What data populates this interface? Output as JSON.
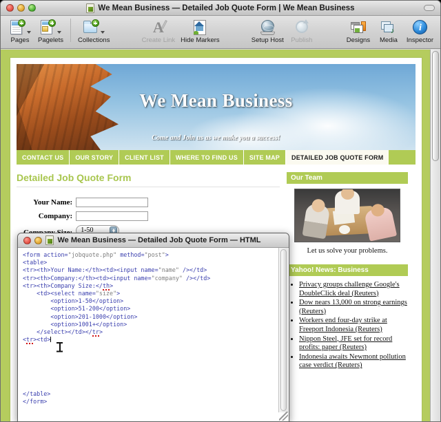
{
  "window": {
    "title": "We Mean Business — Detailed Job Quote Form | We Mean Business",
    "traffic": {
      "close": "close",
      "minimize": "minimize",
      "zoom": "zoom"
    }
  },
  "toolbar": {
    "items": [
      {
        "label": "Pages",
        "icon": "pages-icon",
        "dimmed": false,
        "caret": true
      },
      {
        "label": "Pagelets",
        "icon": "pagelets-icon",
        "dimmed": false,
        "caret": true
      },
      {
        "label": "Collections",
        "icon": "collections-icon",
        "dimmed": false,
        "caret": true
      },
      {
        "label": "Create Link",
        "icon": "create-link-icon",
        "dimmed": true,
        "caret": false
      },
      {
        "label": "Hide Markers",
        "icon": "hide-markers-icon",
        "dimmed": false,
        "caret": false
      },
      {
        "label": "Setup Host",
        "icon": "setup-host-icon",
        "dimmed": false,
        "caret": false
      },
      {
        "label": "Publish",
        "icon": "publish-icon",
        "dimmed": true,
        "caret": false
      },
      {
        "label": "Designs",
        "icon": "designs-icon",
        "dimmed": false,
        "caret": false
      },
      {
        "label": "Media",
        "icon": "media-icon",
        "dimmed": false,
        "caret": false
      },
      {
        "label": "Inspector",
        "icon": "inspector-icon",
        "dimmed": false,
        "caret": false
      }
    ]
  },
  "webpage": {
    "banner": {
      "title": "We Mean Business",
      "tagline": "Come and Join us as we make you a success!"
    },
    "nav": [
      {
        "label": "CONTACT US",
        "active": false
      },
      {
        "label": "OUR STORY",
        "active": false
      },
      {
        "label": "CLIENT LIST",
        "active": false
      },
      {
        "label": "WHERE TO FIND US",
        "active": false
      },
      {
        "label": "SITE MAP",
        "active": false
      },
      {
        "label": "DETAILED JOB QUOTE FORM",
        "active": true
      }
    ],
    "main": {
      "heading": "Detailed Job Quote Form",
      "fields": [
        {
          "label": "Your Name:",
          "type": "text",
          "value": ""
        },
        {
          "label": "Company:",
          "type": "text",
          "value": ""
        },
        {
          "label": "Company Size:",
          "type": "select",
          "value": "1-50",
          "options": [
            "1-50",
            "51-200",
            "201-1000",
            "1001+"
          ]
        }
      ]
    },
    "sidebar": {
      "team": {
        "heading": "Our Team",
        "caption": "Let us solve your problems."
      },
      "news": {
        "heading": "Yahoo! News: Business",
        "items": [
          "Privacy groups challenge Google's DoubleClick deal (Reuters)",
          "Dow nears 13,000 on strong earnings (Reuters)",
          "Workers end four-day strike at Freeport Indonesia (Reuters)",
          "Nippon Steel, JFE set for record profits: paper (Reuters)",
          "Indonesia awaits Newmont pollution case verdict (Reuters)"
        ]
      }
    }
  },
  "code_window": {
    "title": "We Mean Business — Detailed Job Quote Form — HTML",
    "source": "<form action=\"jobquote.php\" method=\"post\">\n<table>\n<tr><th>Your Name:</th><td><input name=\"name\" /></td>\n<tr><th>Company:</th><td><input name=\"company\" /></td>\n<tr><th>Company Size:</th>\n    <td><select name=\"size\">\n        <option>1-50</option>\n        <option>51-200</option>\n        <option>201-1000</option>\n        <option>1001+</option>\n    </select></td></tr>\n<tr><td>\n\n\n\n\n\n\n\n</table>\n</form>"
  },
  "colors": {
    "brand_green": "#b0cb55",
    "canvas_olive": "#b5cc5e",
    "heading_green": "#a8c64e",
    "code_tag": "#3a3fae",
    "code_attr": "#7d7d7d",
    "spellcheck_red": "#d01010"
  }
}
